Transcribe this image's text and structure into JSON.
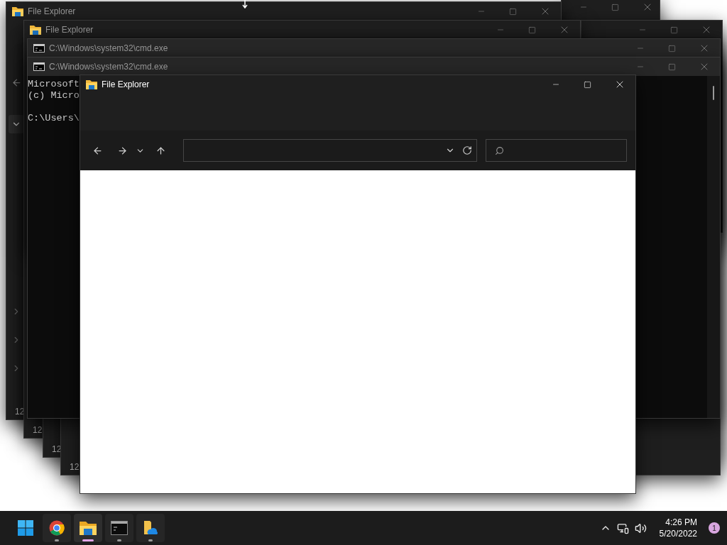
{
  "windows": [
    {
      "kind": "explorer",
      "focused": false
    },
    {
      "kind": "explorer",
      "title": "File Explorer",
      "focused": false,
      "nav_items": [
        {
          "expanded": true,
          "selected": true
        },
        {
          "expanded": false,
          "selected": false
        },
        {
          "expanded": false,
          "selected": false
        },
        {
          "expanded": false,
          "selected": false
        }
      ],
      "footer": "12"
    },
    {
      "kind": "explorer",
      "focused": false
    },
    {
      "kind": "explorer",
      "title": "File Explorer",
      "focused": false,
      "footer": "12"
    },
    {
      "kind": "explorer",
      "footer": "12"
    },
    {
      "kind": "explorer",
      "footer": "12"
    },
    {
      "kind": "cmd",
      "title": "C:\\Windows\\system32\\cmd.exe",
      "focused": false
    },
    {
      "kind": "cmd",
      "title": "C:\\Windows\\system32\\cmd.exe",
      "focused": false,
      "console_lines": [
        "Microsoft",
        "(c) Micro"
      ],
      "prompt": "C:\\Users\\"
    },
    {
      "kind": "explorer",
      "title": "File Explorer",
      "focused": true,
      "toolbar": true
    }
  ],
  "taskbar": {
    "apps": [
      {
        "kind": "start",
        "running": false,
        "selected": false
      },
      {
        "kind": "chrome",
        "running": true,
        "selected": false
      },
      {
        "kind": "explorer",
        "running": true,
        "selected": true
      },
      {
        "kind": "terminal",
        "running": true,
        "selected": false
      },
      {
        "kind": "onedrive",
        "running": true,
        "selected": false
      }
    ],
    "time": "4:26 PM",
    "date": "5/20/2022",
    "notification_count": "1"
  }
}
